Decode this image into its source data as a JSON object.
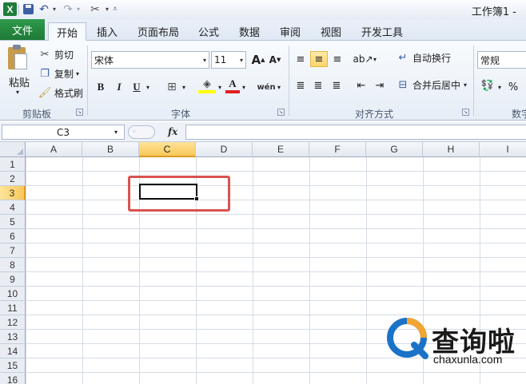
{
  "window": {
    "title": "工作簿1 -"
  },
  "quick_access": {
    "app_logo": "X"
  },
  "ribbon_tabs": [
    {
      "label": "文件"
    },
    {
      "label": "开始"
    },
    {
      "label": "插入"
    },
    {
      "label": "页面布局"
    },
    {
      "label": "公式"
    },
    {
      "label": "数据"
    },
    {
      "label": "审阅"
    },
    {
      "label": "视图"
    },
    {
      "label": "开发工具"
    }
  ],
  "clipboard": {
    "paste_label": "粘贴",
    "cut_label": "剪切",
    "copy_label": "复制",
    "format_painter_label": "格式刷",
    "group_label": "剪贴板"
  },
  "font": {
    "font_name": "宋体",
    "font_size": "11",
    "grow_label": "A",
    "shrink_label": "A",
    "bold": "B",
    "italic": "I",
    "underline": "U",
    "color_letter": "A",
    "phonetic_label": "wén",
    "group_label": "字体"
  },
  "alignment": {
    "wrap_label": "自动换行",
    "merge_label": "合并后居中",
    "group_label": "对齐方式"
  },
  "number": {
    "format": "常规",
    "percent": "%",
    "group_label": "数字"
  },
  "formula_bar": {
    "name_box": "C3",
    "fx": "fx"
  },
  "columns": [
    "A",
    "B",
    "C",
    "D",
    "E",
    "F",
    "G",
    "H",
    "I"
  ],
  "rows": [
    "1",
    "2",
    "3",
    "4",
    "5",
    "6",
    "7",
    "8",
    "9",
    "10",
    "11",
    "12",
    "13",
    "14",
    "15",
    "16"
  ],
  "selection": {
    "cell": "C3",
    "column": "C",
    "row": "3"
  },
  "colors": {
    "file_tab": "#1d7a36",
    "selection_header": "#f8c858",
    "highlight_box": "#d9534f",
    "watermark_blue": "#1a73c9",
    "watermark_orange": "#f2a531"
  },
  "watermark": {
    "text": "查询啦",
    "url": "chaxunla.com"
  }
}
